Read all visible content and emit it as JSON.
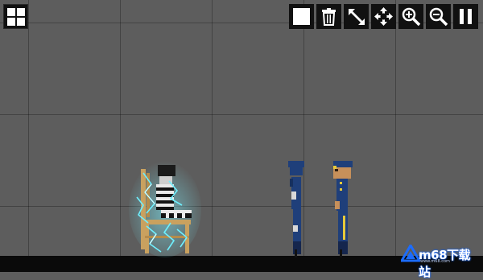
{
  "game": {
    "scene": "sandbox-playground",
    "state": "running"
  },
  "toolbar": {
    "menu": {
      "icon": "grid-menu-icon"
    },
    "buttons": [
      {
        "name": "stop-button",
        "icon": "square-icon"
      },
      {
        "name": "delete-button",
        "icon": "trash-icon"
      },
      {
        "name": "drag-tool-button",
        "icon": "drag-arrow-icon"
      },
      {
        "name": "move-camera-button",
        "icon": "move-arrows-icon"
      },
      {
        "name": "zoom-in-button",
        "icon": "zoom-in-icon"
      },
      {
        "name": "zoom-out-button",
        "icon": "zoom-out-icon"
      },
      {
        "name": "pause-button",
        "icon": "pause-icon"
      }
    ]
  },
  "watermark": {
    "text": "m68下载站",
    "subtext": "www.m68.com"
  },
  "colors": {
    "background": "#5d5d5d",
    "ground": "#0a0a0a",
    "button": "#111111",
    "electric": "#5ee7ff",
    "uniform": "#1f3f7a",
    "chair": "#c9a15f"
  }
}
